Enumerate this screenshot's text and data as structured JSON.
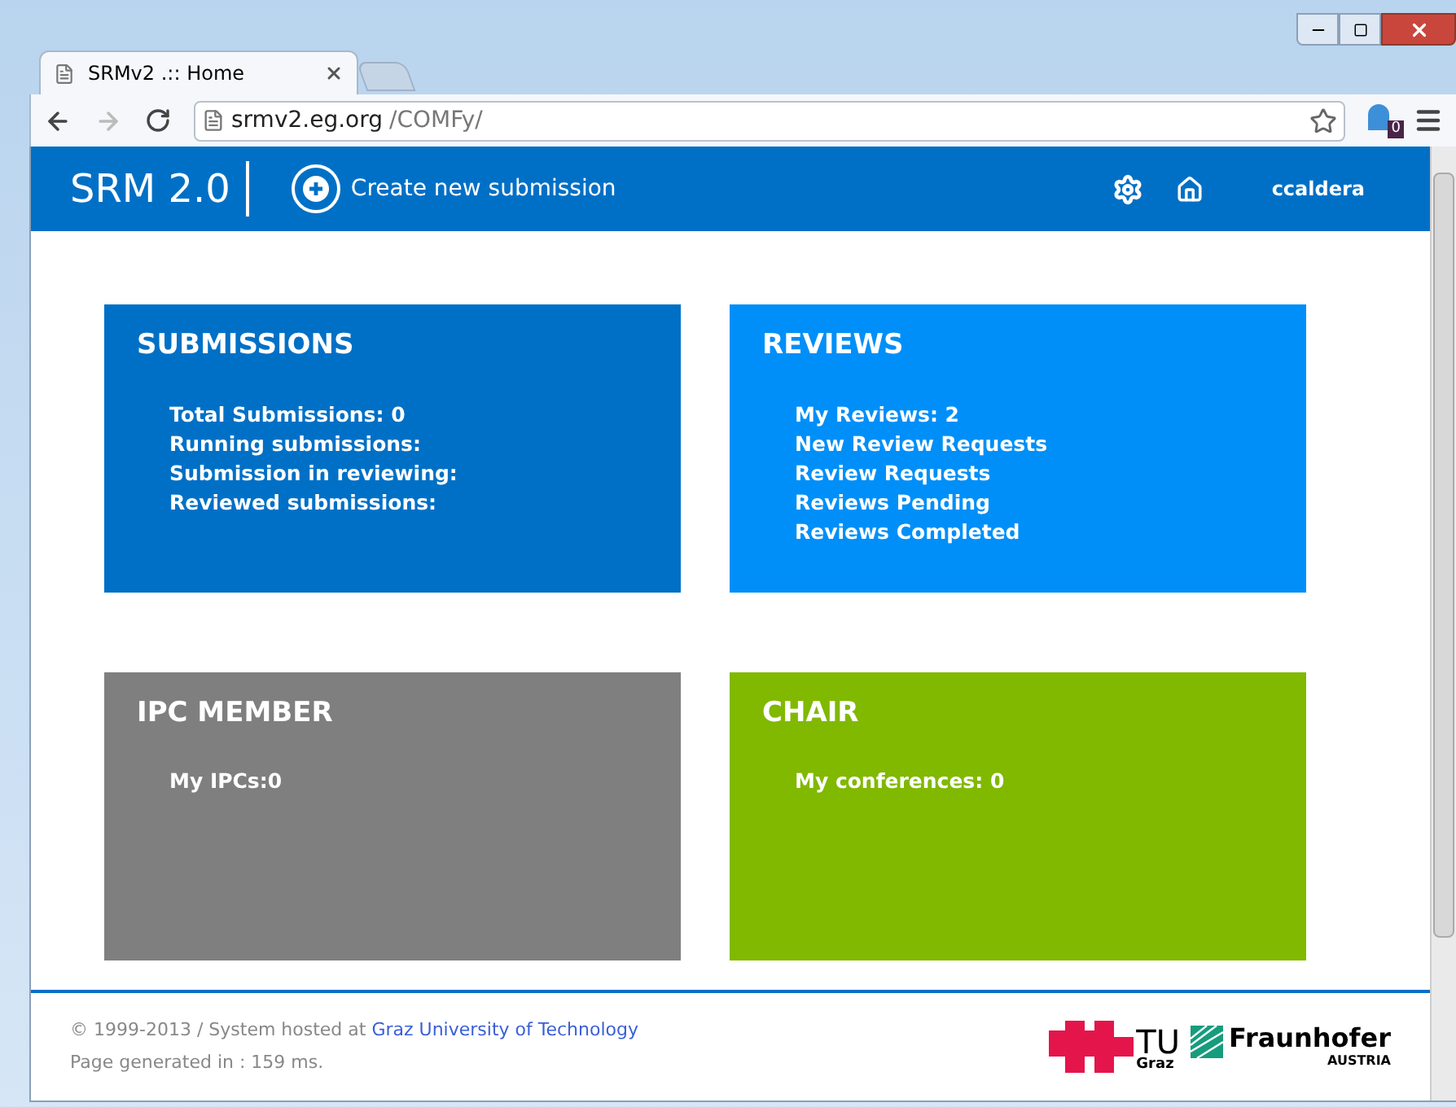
{
  "browser": {
    "tab_title": "SRMv2 .:: Home",
    "url_host": "srmv2.eg.org",
    "url_path": "/COMFy/",
    "extension_badge": "0"
  },
  "header": {
    "logo": "SRM 2.0",
    "create": "Create new submission",
    "user": "ccaldera"
  },
  "cards": [
    {
      "title": "SUBMISSIONS",
      "color": "#0070c6",
      "lines": [
        "Total Submissions: 0",
        "Running submissions:",
        "Submission in reviewing:",
        "Reviewed submissions:"
      ]
    },
    {
      "title": "REVIEWS",
      "color": "#008ff8",
      "lines": [
        "My Reviews: 2",
        "New Review Requests",
        "Review Requests",
        "Reviews Pending",
        "Reviews Completed"
      ]
    },
    {
      "title": "IPC MEMBER",
      "color": "#7f7f7f",
      "lines": [
        "My IPCs:0"
      ]
    },
    {
      "title": "CHAIR",
      "color": "#80b900",
      "lines": [
        "My conferences: 0"
      ]
    }
  ],
  "footer": {
    "copyright": "© 1999-2013 / System hosted at",
    "host_link": "Graz University of Technology",
    "generated": "Page generated in : 159 ms.",
    "tu_logo": "TU",
    "tu_sub": "Graz",
    "fraunhofer": "Fraunhofer",
    "fraunhofer_sub": "AUSTRIA"
  }
}
